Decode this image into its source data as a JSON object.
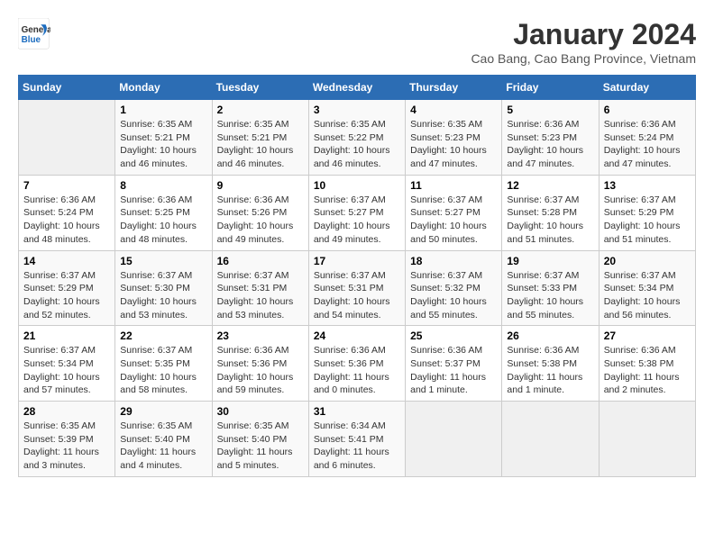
{
  "header": {
    "logo_line1": "General",
    "logo_line2": "Blue",
    "month_title": "January 2024",
    "subtitle": "Cao Bang, Cao Bang Province, Vietnam"
  },
  "days_of_week": [
    "Sunday",
    "Monday",
    "Tuesday",
    "Wednesday",
    "Thursday",
    "Friday",
    "Saturday"
  ],
  "weeks": [
    [
      {
        "num": "",
        "info": ""
      },
      {
        "num": "1",
        "info": "Sunrise: 6:35 AM\nSunset: 5:21 PM\nDaylight: 10 hours\nand 46 minutes."
      },
      {
        "num": "2",
        "info": "Sunrise: 6:35 AM\nSunset: 5:21 PM\nDaylight: 10 hours\nand 46 minutes."
      },
      {
        "num": "3",
        "info": "Sunrise: 6:35 AM\nSunset: 5:22 PM\nDaylight: 10 hours\nand 46 minutes."
      },
      {
        "num": "4",
        "info": "Sunrise: 6:35 AM\nSunset: 5:23 PM\nDaylight: 10 hours\nand 47 minutes."
      },
      {
        "num": "5",
        "info": "Sunrise: 6:36 AM\nSunset: 5:23 PM\nDaylight: 10 hours\nand 47 minutes."
      },
      {
        "num": "6",
        "info": "Sunrise: 6:36 AM\nSunset: 5:24 PM\nDaylight: 10 hours\nand 47 minutes."
      }
    ],
    [
      {
        "num": "7",
        "info": "Sunrise: 6:36 AM\nSunset: 5:24 PM\nDaylight: 10 hours\nand 48 minutes."
      },
      {
        "num": "8",
        "info": "Sunrise: 6:36 AM\nSunset: 5:25 PM\nDaylight: 10 hours\nand 48 minutes."
      },
      {
        "num": "9",
        "info": "Sunrise: 6:36 AM\nSunset: 5:26 PM\nDaylight: 10 hours\nand 49 minutes."
      },
      {
        "num": "10",
        "info": "Sunrise: 6:37 AM\nSunset: 5:27 PM\nDaylight: 10 hours\nand 49 minutes."
      },
      {
        "num": "11",
        "info": "Sunrise: 6:37 AM\nSunset: 5:27 PM\nDaylight: 10 hours\nand 50 minutes."
      },
      {
        "num": "12",
        "info": "Sunrise: 6:37 AM\nSunset: 5:28 PM\nDaylight: 10 hours\nand 51 minutes."
      },
      {
        "num": "13",
        "info": "Sunrise: 6:37 AM\nSunset: 5:29 PM\nDaylight: 10 hours\nand 51 minutes."
      }
    ],
    [
      {
        "num": "14",
        "info": "Sunrise: 6:37 AM\nSunset: 5:29 PM\nDaylight: 10 hours\nand 52 minutes."
      },
      {
        "num": "15",
        "info": "Sunrise: 6:37 AM\nSunset: 5:30 PM\nDaylight: 10 hours\nand 53 minutes."
      },
      {
        "num": "16",
        "info": "Sunrise: 6:37 AM\nSunset: 5:31 PM\nDaylight: 10 hours\nand 53 minutes."
      },
      {
        "num": "17",
        "info": "Sunrise: 6:37 AM\nSunset: 5:31 PM\nDaylight: 10 hours\nand 54 minutes."
      },
      {
        "num": "18",
        "info": "Sunrise: 6:37 AM\nSunset: 5:32 PM\nDaylight: 10 hours\nand 55 minutes."
      },
      {
        "num": "19",
        "info": "Sunrise: 6:37 AM\nSunset: 5:33 PM\nDaylight: 10 hours\nand 55 minutes."
      },
      {
        "num": "20",
        "info": "Sunrise: 6:37 AM\nSunset: 5:34 PM\nDaylight: 10 hours\nand 56 minutes."
      }
    ],
    [
      {
        "num": "21",
        "info": "Sunrise: 6:37 AM\nSunset: 5:34 PM\nDaylight: 10 hours\nand 57 minutes."
      },
      {
        "num": "22",
        "info": "Sunrise: 6:37 AM\nSunset: 5:35 PM\nDaylight: 10 hours\nand 58 minutes."
      },
      {
        "num": "23",
        "info": "Sunrise: 6:36 AM\nSunset: 5:36 PM\nDaylight: 10 hours\nand 59 minutes."
      },
      {
        "num": "24",
        "info": "Sunrise: 6:36 AM\nSunset: 5:36 PM\nDaylight: 11 hours\nand 0 minutes."
      },
      {
        "num": "25",
        "info": "Sunrise: 6:36 AM\nSunset: 5:37 PM\nDaylight: 11 hours\nand 1 minute."
      },
      {
        "num": "26",
        "info": "Sunrise: 6:36 AM\nSunset: 5:38 PM\nDaylight: 11 hours\nand 1 minute."
      },
      {
        "num": "27",
        "info": "Sunrise: 6:36 AM\nSunset: 5:38 PM\nDaylight: 11 hours\nand 2 minutes."
      }
    ],
    [
      {
        "num": "28",
        "info": "Sunrise: 6:35 AM\nSunset: 5:39 PM\nDaylight: 11 hours\nand 3 minutes."
      },
      {
        "num": "29",
        "info": "Sunrise: 6:35 AM\nSunset: 5:40 PM\nDaylight: 11 hours\nand 4 minutes."
      },
      {
        "num": "30",
        "info": "Sunrise: 6:35 AM\nSunset: 5:40 PM\nDaylight: 11 hours\nand 5 minutes."
      },
      {
        "num": "31",
        "info": "Sunrise: 6:34 AM\nSunset: 5:41 PM\nDaylight: 11 hours\nand 6 minutes."
      },
      {
        "num": "",
        "info": ""
      },
      {
        "num": "",
        "info": ""
      },
      {
        "num": "",
        "info": ""
      }
    ]
  ]
}
